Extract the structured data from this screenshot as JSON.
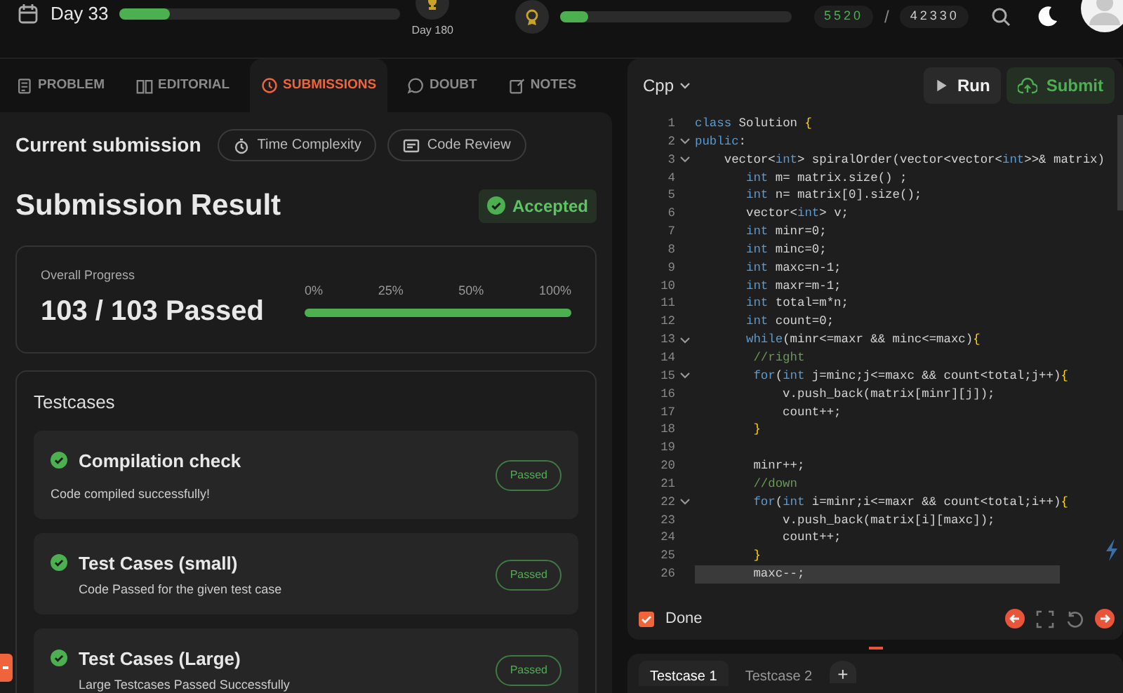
{
  "topbar": {
    "streak": {
      "label": "Day 33",
      "level": 0.18
    },
    "milestone": {
      "label": "Day 180"
    },
    "xp": {
      "level": 0.12,
      "score": "5520",
      "separator": "/",
      "total": "42330"
    }
  },
  "tabs": [
    {
      "label": "PROBLEM",
      "kind": "doc",
      "selected": false
    },
    {
      "label": "EDITORIAL",
      "kind": "book",
      "selected": false
    },
    {
      "label": "SUBMISSIONS",
      "kind": "clock",
      "selected": true
    },
    {
      "label": "DOUBT",
      "kind": "chat",
      "selected": false
    },
    {
      "label": "NOTES",
      "kind": "note",
      "selected": false
    }
  ],
  "submission": {
    "title": "Current submission",
    "chips": [
      {
        "label": "Time Complexity",
        "kind": "timer"
      },
      {
        "label": "Code Review",
        "kind": "review"
      }
    ],
    "heading": "Submission Result",
    "status": "Accepted",
    "progress": {
      "caption": "Overall Progress",
      "value": "103 / 103 Passed",
      "ticks": [
        "0%",
        "25%",
        "50%",
        "100%"
      ],
      "level": 1
    }
  },
  "testcases": {
    "title": "Testcases",
    "items": [
      {
        "name": "Compilation check",
        "detail": "Code compiled successfully!",
        "status": "Passed"
      },
      {
        "name": "Test Cases (small)",
        "detail": "Code Passed for the given test case",
        "status": "Passed"
      },
      {
        "name": "Test Cases (Large)",
        "detail": "Large Testcases Passed Successfully",
        "status": "Passed"
      }
    ]
  },
  "editor": {
    "language": "Cpp",
    "buttons": [
      {
        "label": "Run",
        "kind": "run"
      },
      {
        "label": "Submit",
        "kind": "submit"
      }
    ],
    "lines": [
      {
        "number": "1",
        "fold": false,
        "selected": false,
        "tokens": [
          {
            "kind": "keyword",
            "text": "class"
          },
          {
            "kind": "plain",
            "text": " Solution "
          },
          {
            "kind": "brace",
            "text": "{"
          }
        ]
      },
      {
        "number": "2",
        "fold": true,
        "selected": false,
        "tokens": [
          {
            "kind": "keyword",
            "text": "public"
          },
          {
            "kind": "plain",
            "text": ":"
          }
        ]
      },
      {
        "number": "3",
        "fold": true,
        "selected": false,
        "tokens": [
          {
            "kind": "plain",
            "text": "    vector<"
          },
          {
            "kind": "keyword",
            "text": "int"
          },
          {
            "kind": "plain",
            "text": "> spiralOrder(vector<vector<"
          },
          {
            "kind": "keyword",
            "text": "int"
          },
          {
            "kind": "plain",
            "text": ">>& matrix)"
          }
        ]
      },
      {
        "number": "4",
        "fold": false,
        "selected": false,
        "tokens": [
          {
            "kind": "keyword",
            "text": "       int"
          },
          {
            "kind": "plain",
            "text": " m= matrix.size() ;"
          }
        ]
      },
      {
        "number": "5",
        "fold": false,
        "selected": false,
        "tokens": [
          {
            "kind": "keyword",
            "text": "       int"
          },
          {
            "kind": "plain",
            "text": " n= matrix[0].size();"
          }
        ]
      },
      {
        "number": "6",
        "fold": false,
        "selected": false,
        "tokens": [
          {
            "kind": "plain",
            "text": "       vector<"
          },
          {
            "kind": "keyword",
            "text": "int"
          },
          {
            "kind": "plain",
            "text": "> v;"
          }
        ]
      },
      {
        "number": "7",
        "fold": false,
        "selected": false,
        "tokens": [
          {
            "kind": "keyword",
            "text": "       int"
          },
          {
            "kind": "plain",
            "text": " minr=0;"
          }
        ]
      },
      {
        "number": "8",
        "fold": false,
        "selected": false,
        "tokens": [
          {
            "kind": "keyword",
            "text": "       int"
          },
          {
            "kind": "plain",
            "text": " minc=0;"
          }
        ]
      },
      {
        "number": "9",
        "fold": false,
        "selected": false,
        "tokens": [
          {
            "kind": "keyword",
            "text": "       int"
          },
          {
            "kind": "plain",
            "text": " maxc=n-1;"
          }
        ]
      },
      {
        "number": "10",
        "fold": false,
        "selected": false,
        "tokens": [
          {
            "kind": "keyword",
            "text": "       int"
          },
          {
            "kind": "plain",
            "text": " maxr=m-1;"
          }
        ]
      },
      {
        "number": "11",
        "fold": false,
        "selected": false,
        "tokens": [
          {
            "kind": "keyword",
            "text": "       int"
          },
          {
            "kind": "plain",
            "text": " total=m*n;"
          }
        ]
      },
      {
        "number": "12",
        "fold": false,
        "selected": false,
        "tokens": [
          {
            "kind": "keyword",
            "text": "       int"
          },
          {
            "kind": "plain",
            "text": " count=0;"
          }
        ]
      },
      {
        "number": "13",
        "fold": true,
        "selected": false,
        "tokens": [
          {
            "kind": "keyword",
            "text": "       while"
          },
          {
            "kind": "plain",
            "text": "(minr<=maxr && minc<=maxc)"
          },
          {
            "kind": "brace",
            "text": "{"
          }
        ]
      },
      {
        "number": "14",
        "fold": false,
        "selected": false,
        "tokens": [
          {
            "kind": "comment",
            "text": "        //right"
          }
        ]
      },
      {
        "number": "15",
        "fold": true,
        "selected": false,
        "tokens": [
          {
            "kind": "keyword",
            "text": "        for"
          },
          {
            "kind": "plain",
            "text": "("
          },
          {
            "kind": "keyword",
            "text": "int"
          },
          {
            "kind": "plain",
            "text": " j=minc;j<=maxc && count<total;j++)"
          },
          {
            "kind": "brace",
            "text": "{"
          }
        ]
      },
      {
        "number": "16",
        "fold": false,
        "selected": false,
        "tokens": [
          {
            "kind": "plain",
            "text": "            v.push_back(matrix[minr][j]);"
          }
        ]
      },
      {
        "number": "17",
        "fold": false,
        "selected": false,
        "tokens": [
          {
            "kind": "plain",
            "text": "            count++;"
          }
        ]
      },
      {
        "number": "18",
        "fold": false,
        "selected": false,
        "tokens": [
          {
            "kind": "brace",
            "text": "        }"
          }
        ]
      },
      {
        "number": "19",
        "fold": false,
        "selected": false
      },
      {
        "number": "20",
        "fold": false,
        "selected": false,
        "tokens": [
          {
            "kind": "plain",
            "text": "        minr++;"
          }
        ]
      },
      {
        "number": "21",
        "fold": false,
        "selected": false,
        "tokens": [
          {
            "kind": "comment",
            "text": "        //down"
          }
        ]
      },
      {
        "number": "22",
        "fold": true,
        "selected": false,
        "tokens": [
          {
            "kind": "keyword",
            "text": "        for"
          },
          {
            "kind": "plain",
            "text": "("
          },
          {
            "kind": "keyword",
            "text": "int"
          },
          {
            "kind": "plain",
            "text": " i=minr;i<=maxr && count<total;i++)"
          },
          {
            "kind": "brace",
            "text": "{"
          }
        ]
      },
      {
        "number": "23",
        "fold": false,
        "selected": false,
        "tokens": [
          {
            "kind": "plain",
            "text": "            v.push_back(matrix[i][maxc]);"
          }
        ]
      },
      {
        "number": "24",
        "fold": false,
        "selected": false,
        "tokens": [
          {
            "kind": "plain",
            "text": "            count++;"
          }
        ]
      },
      {
        "number": "25",
        "fold": false,
        "selected": false,
        "tokens": [
          {
            "kind": "brace",
            "text": "        }"
          }
        ]
      },
      {
        "number": "26",
        "fold": false,
        "selected": true,
        "tokens": [
          {
            "kind": "plain",
            "text": "        maxc--;"
          }
        ]
      }
    ],
    "done": {
      "label": "Done",
      "checked": true
    }
  },
  "bottom_tabs": [
    {
      "label": "Testcase 1",
      "selected": true
    },
    {
      "label": "Testcase 2",
      "selected": false
    }
  ],
  "add_tab": "+"
}
